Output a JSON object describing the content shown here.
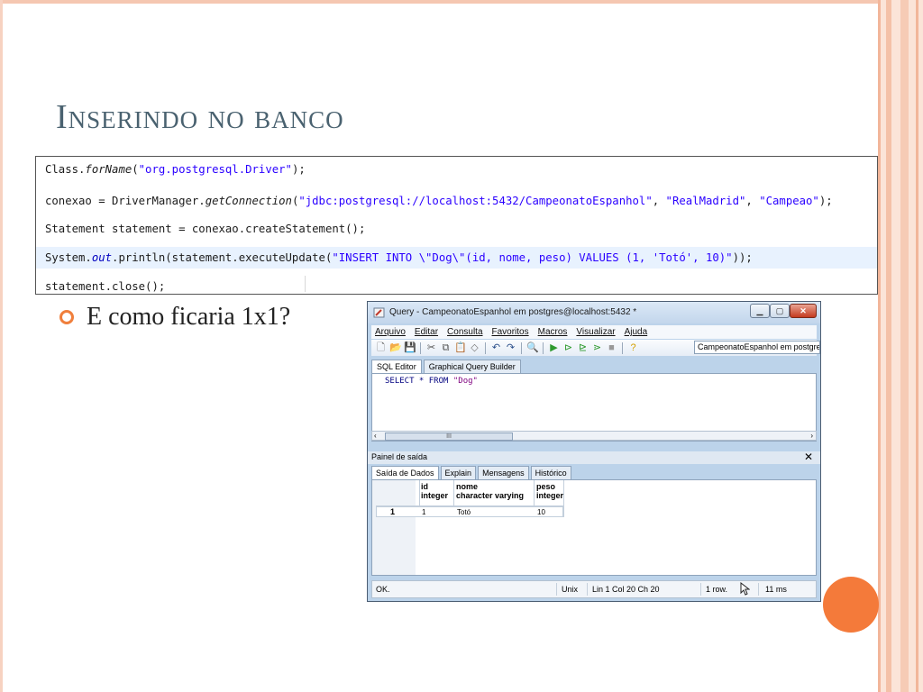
{
  "slide": {
    "title": "Inserindo no banco",
    "bullet_text": "E como ficaria 1x1?"
  },
  "code": {
    "line1": {
      "a": "Class.",
      "b": "forName",
      "c": "(",
      "d": "\"org.postgresql.Driver\"",
      "e": ");"
    },
    "line2": {
      "a": "conexao = DriverManager.",
      "b": "getConnection",
      "c": "(",
      "d": "\"jdbc:postgresql://localhost:5432/CampeonatoEspanhol\"",
      "e": ", ",
      "f": "\"RealMadrid\"",
      "g": ", ",
      "h": "\"Campeao\"",
      "i": ");"
    },
    "line3": "Statement statement = conexao.createStatement();",
    "line4": {
      "a": "System.",
      "b": "out",
      "c": ".println(statement.executeUpdate(",
      "d": "\"INSERT INTO \\\"Dog\\\"(id, nome, peso) VALUES (1, 'Totó', 10)\"",
      "e": "));"
    },
    "line5": "statement.close();"
  },
  "window": {
    "title": "Query - CampeonatoEspanhol em postgres@localhost:5432 *",
    "menu": [
      "Arquivo",
      "Editar",
      "Consulta",
      "Favoritos",
      "Macros",
      "Visualizar",
      "Ajuda"
    ],
    "connection": "CampeonatoEspanhol em postgres",
    "editor_tabs": [
      "SQL Editor",
      "Graphical Query Builder"
    ],
    "sql": {
      "a": "SELECT * FROM ",
      "b": "\"Dog\""
    },
    "scroll_thumb": "III",
    "output_panel_title": "Painel de saída",
    "output_tabs": [
      "Saída de Dados",
      "Explain",
      "Mensagens",
      "Histórico"
    ],
    "grid": {
      "columns": [
        {
          "name": "id",
          "type": "integer"
        },
        {
          "name": "nome",
          "type": "character varying"
        },
        {
          "name": "peso",
          "type": "integer"
        }
      ],
      "rows": [
        {
          "num": "1",
          "cells": [
            "1",
            "Totó",
            "10"
          ]
        }
      ]
    },
    "status": {
      "message": "OK.",
      "line_ending": "Unix",
      "position": "Lin 1 Col 20 Ch 20",
      "rows": "1 row.",
      "time": "11 ms"
    }
  },
  "colors": {
    "accent": "#f47a3a",
    "title": "#4a6270",
    "string": "#2a00ff"
  }
}
